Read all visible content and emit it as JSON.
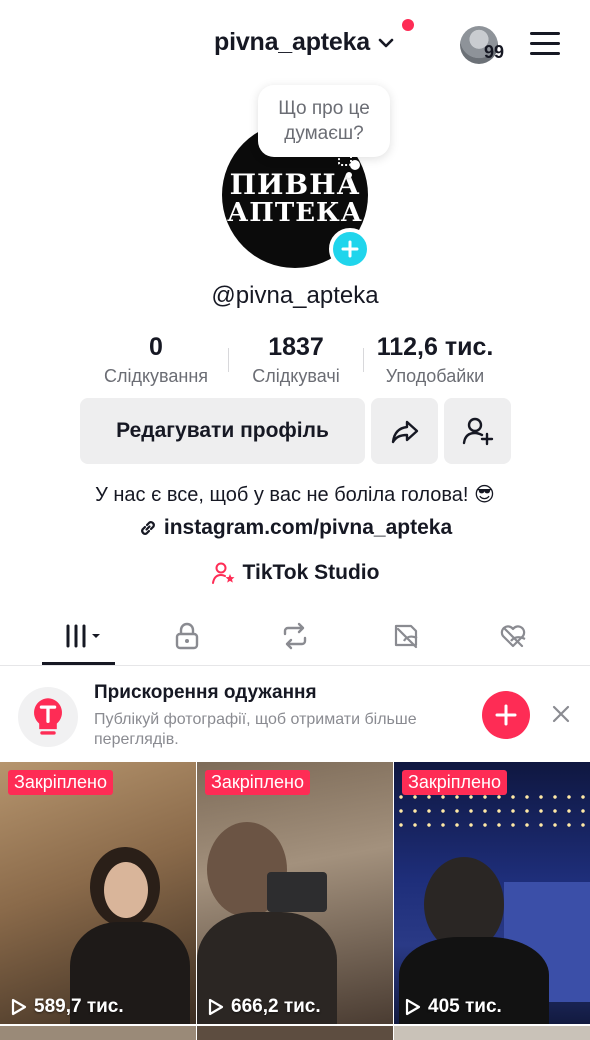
{
  "header": {
    "username": "pivna_apteka",
    "notification_count": "99"
  },
  "profile": {
    "bubble_text": "Що про це\nдумаєш?",
    "logo_line1": "ПИВНА",
    "logo_line2": "АПТЕКА",
    "handle": "@pivna_apteka",
    "stats": [
      {
        "value": "0",
        "label": "Слідкування"
      },
      {
        "value": "1837",
        "label": "Слідкувачі"
      },
      {
        "value": "112,6 тис.",
        "label": "Уподобайки"
      }
    ],
    "edit_button": "Редагувати профіль",
    "bio": "У нас є все, щоб у вас не боліла голова! 😎",
    "link": "instagram.com/pivna_apteka",
    "studio": "TikTok Studio"
  },
  "tabs": [
    {
      "icon": "grid-icon",
      "active": true
    },
    {
      "icon": "lock-icon"
    },
    {
      "icon": "repost-icon"
    },
    {
      "icon": "hidden-tag-icon"
    },
    {
      "icon": "liked-hidden-icon"
    }
  ],
  "promo": {
    "title": "Прискорення одужання",
    "description": "Публікуй фотографії, щоб отримати більше переглядів."
  },
  "videos": [
    {
      "pinned_label": "Закріплено",
      "views": "589,7 тис."
    },
    {
      "pinned_label": "Закріплено",
      "views": "666,2 тис."
    },
    {
      "pinned_label": "Закріплено",
      "views": "405 тис."
    }
  ],
  "colors": {
    "accent": "#fe2c55",
    "badge": "#20d5ec",
    "text": "#161823",
    "muted": "#6b6d74"
  }
}
